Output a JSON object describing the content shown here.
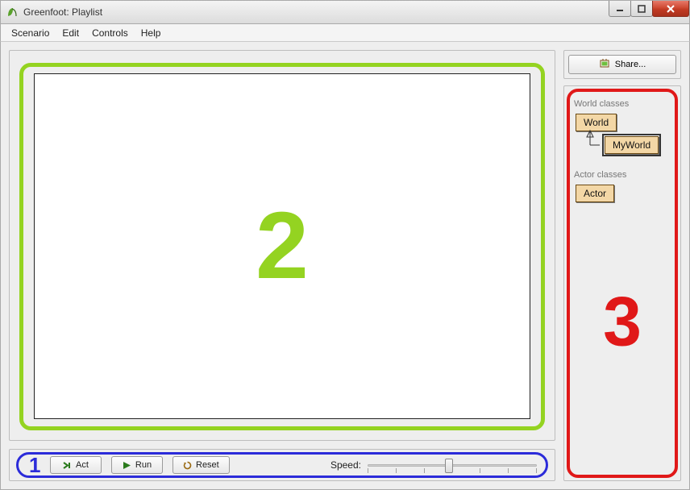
{
  "window": {
    "title": "Greenfoot: Playlist"
  },
  "menu": {
    "items": [
      "Scenario",
      "Edit",
      "Controls",
      "Help"
    ]
  },
  "controls": {
    "act_label": "Act",
    "run_label": "Run",
    "reset_label": "Reset",
    "speed_label": "Speed:",
    "speed_value": 48,
    "speed_min": 0,
    "speed_max": 100
  },
  "share": {
    "label": "Share..."
  },
  "classes": {
    "world_group_label": "World classes",
    "actor_group_label": "Actor classes",
    "world_root": "World",
    "world_child": "MyWorld",
    "actor_root": "Actor"
  },
  "annotations": {
    "one": "1",
    "two": "2",
    "three": "3"
  }
}
